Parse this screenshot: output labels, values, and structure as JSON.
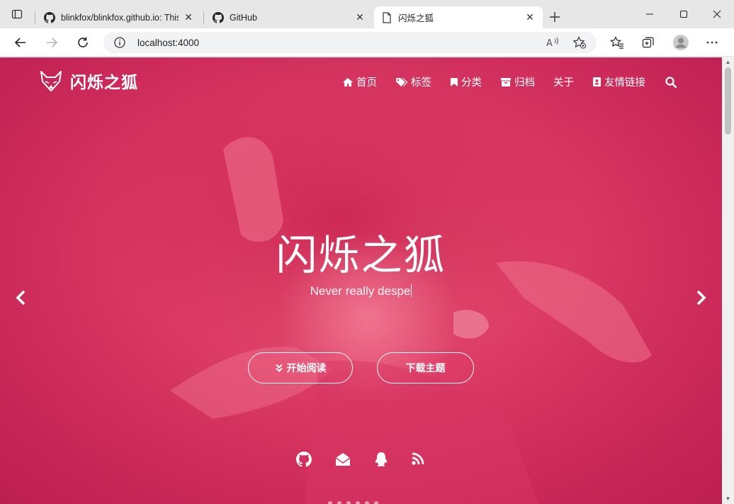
{
  "browser": {
    "tabs": [
      {
        "title": "blinkfox/blinkfox.github.io: This i",
        "icon": "github-icon"
      },
      {
        "title": "GitHub",
        "icon": "github-icon"
      },
      {
        "title": "闪烁之狐",
        "icon": "page-icon",
        "active": true
      }
    ],
    "address": {
      "url": "localhost:4000"
    }
  },
  "site": {
    "logo_text": "闪烁之狐",
    "menu": [
      {
        "label": "首页",
        "icon": "home-icon"
      },
      {
        "label": "标签",
        "icon": "tags-icon"
      },
      {
        "label": "分类",
        "icon": "bookmark-icon"
      },
      {
        "label": "归档",
        "icon": "archive-icon"
      },
      {
        "label": "关于",
        "icon": "user-icon"
      },
      {
        "label": "友情链接",
        "icon": "address-book-icon"
      }
    ],
    "hero_title": "闪烁之狐",
    "hero_subtitle": "Never really despe",
    "start_reading": "开始阅读",
    "download_theme": "下载主题",
    "social": [
      "github-icon",
      "mail-icon",
      "qq-icon",
      "rss-icon"
    ],
    "accent_color": "#d92f5e"
  }
}
